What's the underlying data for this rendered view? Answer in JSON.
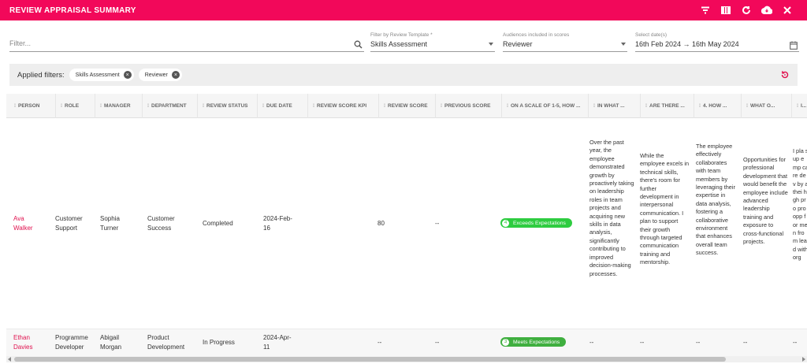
{
  "header": {
    "title": "REVIEW APPRAISAL SUMMARY",
    "actions": [
      "filter-icon",
      "columns-icon",
      "refresh-icon",
      "cloud-download-icon",
      "close-icon"
    ],
    "color": "#f2085a"
  },
  "filters": {
    "search_placeholder": "Filter...",
    "template": {
      "label": "Filter by Review Template *",
      "value": "Skills Assessment"
    },
    "audiences": {
      "label": "Audiences included in scores",
      "value": "Reviewer"
    },
    "dates": {
      "label": "Select date(s)",
      "value": "16th Feb 2024  →  16th May 2024"
    }
  },
  "applied": {
    "title": "Applied filters:",
    "chips": [
      "Skills Assessment",
      "Reviewer"
    ]
  },
  "table": {
    "columns": [
      "PERSON",
      "ROLE",
      "MANAGER",
      "DEPARTMENT",
      "REVIEW STATUS",
      "DUE DATE",
      "REVIEW SCORE KPI",
      "REVIEW SCORE",
      "PREVIOUS SCORE",
      "ON A SCALE OF 1-5, HOW ...",
      "IN WHAT ...",
      "ARE THERE ...",
      "4. HOW ...",
      "WHAT O...",
      "I..."
    ],
    "rows": [
      {
        "person": "Ava\nWalker",
        "role": "Customer\nSupport",
        "manager": "Sophia\nTurner",
        "department": "Customer\nSuccess",
        "status": "Completed",
        "due": "2024-Feb-\n16",
        "kpi": "",
        "score": "80",
        "previous": "--",
        "rating_num": "4",
        "rating_text": "Exceeds Expectations",
        "rating_color": "#2ecc40",
        "q1": "Over the past year, the employee demonstrated growth by proactively taking on leadership roles in team projects and acquiring new skills in data analysis, significantly contributing to improved decision-making processes.",
        "q2": "While the employee excels in technical skills, there's room for further development in interpersonal communication. I plan to support their growth through targeted communication training and mentorship.",
        "q3": "The employee effectively collaborates with team members by leveraging their expertise in data analysis, fostering a collaborative environment that enhances overall team success.",
        "q4": "Opportunities for professional development that would benefit the employee include advanced leadership training and exposure to cross-functional projects.",
        "q5": "I pla sup emp care dev by a thei high pro pro opp for men from lead with org"
      },
      {
        "person": "Ethan\nDavies",
        "role": "Programme\nDeveloper",
        "manager": "Abigail\nMorgan",
        "department": "Product\nDevelopment",
        "status": "In Progress",
        "due": "2024-Apr-\n11",
        "kpi": "",
        "score": "--",
        "previous": "--",
        "rating_num": "3",
        "rating_text": "Meets Expectations",
        "rating_color": "#3faf3f",
        "q1": "--",
        "q2": "--",
        "q3": "--",
        "q4": "--",
        "q5": "--"
      }
    ]
  }
}
